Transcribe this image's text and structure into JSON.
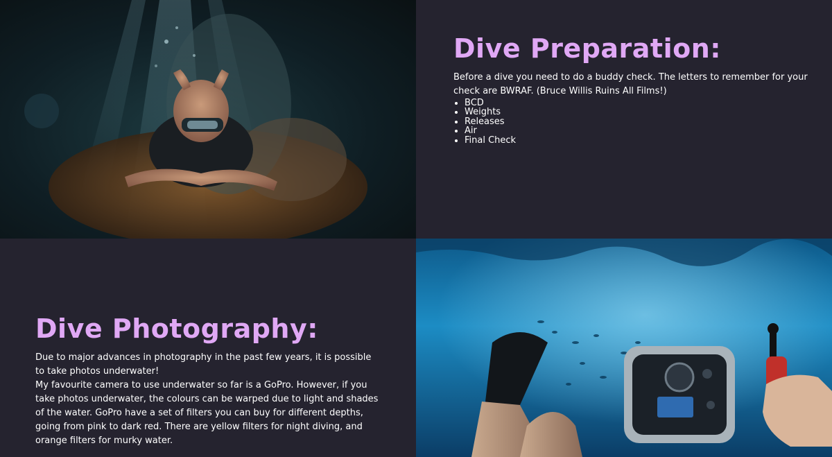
{
  "preparation": {
    "heading": "Dive Preparation:",
    "intro": "Before a dive you need to do a buddy check. The letters to remember for your check are BWRAF. (Bruce Willis Ruins All Films!)",
    "items": [
      "BCD",
      "Weights",
      "Releases",
      "Air",
      "Final Check"
    ]
  },
  "photography": {
    "heading": "Dive Photography:",
    "paragraph_1": "Due to major advances in photography in the past few years, it is possible to take photos underwater!",
    "paragraph_2": "My favourite camera to use underwater so far is a GoPro. However, if you take photos underwater, the colours can be warped due to light and shades of the water. GoPro have a set of filters you can buy for different depths, going from pink to dark red. There are yellow filters for night diving, and orange filters for murky water."
  },
  "colors": {
    "page_background": "#25232f",
    "heading_color": "#e0a8f5",
    "text_color": "#ffffff"
  },
  "images": {
    "top_left": "diver-photo",
    "bottom_right": "underwater-camera-photo"
  }
}
